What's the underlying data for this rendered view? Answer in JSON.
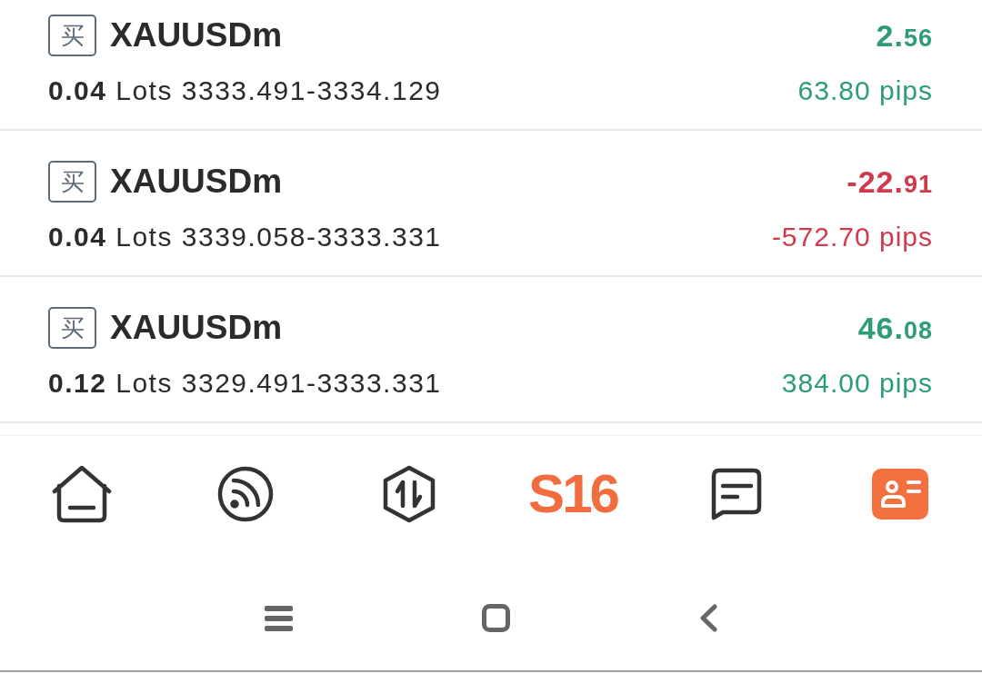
{
  "positions": [
    {
      "side": "买",
      "symbol": "XAUUSDm",
      "detail": "**0.04** Lots 3333.491-3334.129",
      "profit": "2.56",
      "pips": "63.80 pips",
      "loss": false
    },
    {
      "side": "买",
      "symbol": "XAUUSDm",
      "detail": "**0.04** Lots 3339.058-3333.331",
      "profit": "-22.91",
      "pips": "-572.70 pips",
      "loss": true
    },
    {
      "side": "买",
      "symbol": "XAUUSDm",
      "detail": "**0.12** Lots 3329.491-3333.331",
      "profit": "46.08",
      "pips": "384.00 pips",
      "loss": false
    }
  ],
  "tab_bar": [
    {
      "kind": "home",
      "selected": false
    },
    {
      "kind": "feed",
      "selected": false
    },
    {
      "kind": "trade",
      "selected": false
    },
    {
      "kind": "text",
      "label": "S16",
      "selected": false
    },
    {
      "kind": "messages",
      "selected": false
    },
    {
      "kind": "profile",
      "selected": true
    }
  ]
}
